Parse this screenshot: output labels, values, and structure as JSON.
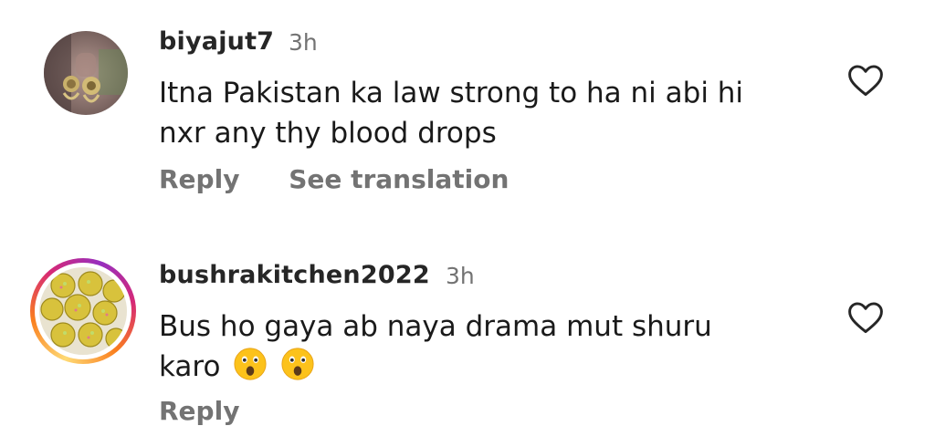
{
  "comments": [
    {
      "username": "biyajut7",
      "time": "3h",
      "text_line1": "Itna Pakistan ka law strong to ha ni abi hi",
      "text_line2": "nxr any thy blood drops",
      "reply_label": "Reply",
      "translate_label": "See translation",
      "avatar_icon": "jewelry-photo-avatar",
      "like_icon": "heart-outline-icon"
    },
    {
      "username": "bushrakitchen2022",
      "time": "3h",
      "text_line1": "Bus ho gaya ab naya drama mut shuru",
      "text_line2": "karo",
      "reply_label": "Reply",
      "avatar_icon": "food-laddu-avatar",
      "like_icon": "heart-outline-icon",
      "emojis": [
        "astonished-face-icon",
        "astonished-face-icon"
      ]
    }
  ],
  "colors": {
    "username": "#262626",
    "secondary": "#737373",
    "ring_start": "#feda75",
    "ring_end": "#962fbf"
  }
}
